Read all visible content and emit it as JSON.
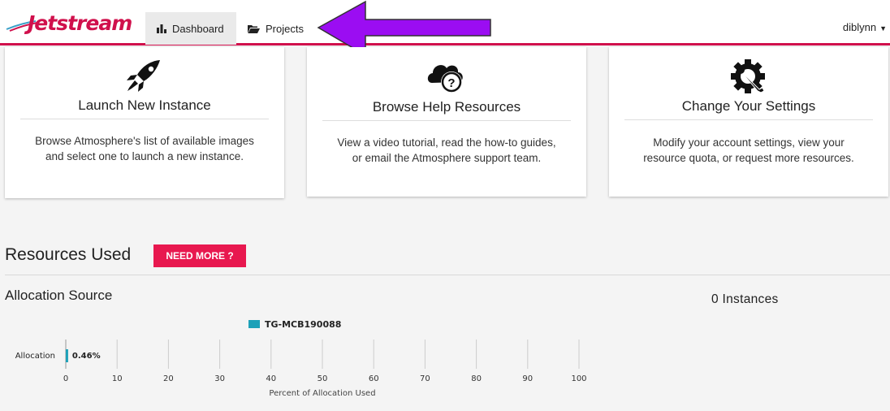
{
  "header": {
    "logo_text": "Jetstream",
    "tabs": [
      {
        "label": "Dashboard",
        "active": true
      },
      {
        "label": "Projects",
        "active": false
      }
    ],
    "username": "diblynn",
    "accent_color": "#d0104c",
    "annotation_arrow_color": "#9b0df2"
  },
  "cards": [
    {
      "icon": "rocket-icon",
      "title": "Launch New Instance",
      "description": "Browse Atmosphere's list of available images and select one to launch a new instance."
    },
    {
      "icon": "cloud-help-icon",
      "title": "Browse Help Resources",
      "description": "View a video tutorial, read the how-to guides, or email the Atmosphere support team."
    },
    {
      "icon": "gear-wrench-icon",
      "title": "Change Your Settings",
      "description": "Modify your account settings, view your resource quota, or request more resources."
    }
  ],
  "resources": {
    "title": "Resources Used",
    "need_more_label": "NEED MORE ?",
    "need_more_color": "#e8184f",
    "allocation_title": "Allocation Source",
    "instances_label": "0 Instances"
  },
  "chart_data": {
    "type": "bar",
    "orientation": "horizontal",
    "categories": [
      "Allocation"
    ],
    "series": [
      {
        "name": "TG-MCB190088",
        "values": [
          0.46
        ],
        "color": "#1da1b8"
      }
    ],
    "value_label": "0.46%",
    "xlabel": "Percent of Allocation Used",
    "xlim": [
      0,
      100
    ],
    "xticks": [
      "0",
      "10",
      "20",
      "30",
      "40",
      "50",
      "60",
      "70",
      "80",
      "90",
      "100"
    ],
    "legend": "top-center",
    "grid": true
  }
}
